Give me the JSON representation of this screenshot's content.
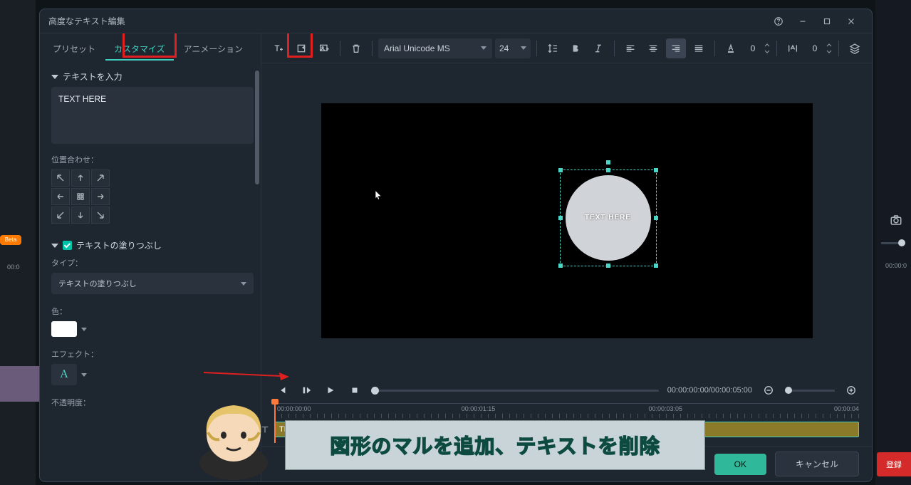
{
  "window": {
    "title": "高度なテキスト編集"
  },
  "tabs": {
    "preset": "プリセット",
    "customize": "カスタマイズ",
    "animation": "アニメーション"
  },
  "sidebar": {
    "section_text_input": "テキストを入力",
    "text_value": "TEXT HERE",
    "align_label": "位置合わせ：",
    "section_fill": "テキストの塗りつぶし",
    "type_label": "タイプ：",
    "type_value": "テキストの塗りつぶし",
    "color_label": "色：",
    "effect_label": "エフェクト：",
    "effect_glyph": "A",
    "opacity_label": "不透明度：",
    "color_value": "#ffffff"
  },
  "toolbar": {
    "font": "Arial Unicode MS",
    "size": "24",
    "tracking": "0",
    "leading": "0"
  },
  "preview": {
    "circle_text": "TEXT HERE"
  },
  "playbar": {
    "timecode": "00:00:00:00/00:00:05:00"
  },
  "timeline": {
    "t0": "00:00:00:00",
    "t1": "00:00:01:15",
    "t2": "00:00:03:05",
    "t3": "00:00:04",
    "clip_label": "TEXT HERE"
  },
  "footer": {
    "ok": "OK",
    "cancel": "キャンセル"
  },
  "overlay": {
    "caption": "図形のマルを追加、テキストを削除",
    "register": "登録"
  },
  "background": {
    "beta": "Beta",
    "tc_left": "00:0",
    "tc_right": "00:00:0"
  }
}
